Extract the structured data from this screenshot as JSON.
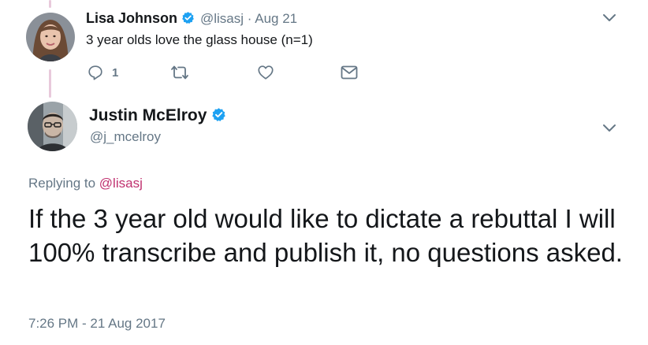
{
  "reply_tweet": {
    "author_name": "Lisa Johnson",
    "author_handle": "@lisasj",
    "separator": "·",
    "date": "Aug 21",
    "text": "3 year olds love the glass house (n=1)",
    "reply_count": "1"
  },
  "main_tweet": {
    "author_name": "Justin McElroy",
    "author_handle": "@j_mcelroy",
    "replying_prefix": "Replying to",
    "replying_to": "@lisasj",
    "text": "If the 3 year old would like to dictate a rebuttal I will 100% transcribe and publish it, no questions asked.",
    "timestamp": "7:26 PM - 21 Aug 2017"
  },
  "icons": {
    "verified": "verified-badge-icon",
    "reply": "reply-icon",
    "retweet": "retweet-icon",
    "like": "heart-icon",
    "dm": "envelope-icon",
    "menu": "chevron-down-icon"
  },
  "colors": {
    "verified_blue": "#1da1f2",
    "thread_line": "#e8c9db",
    "mention": "#c0316f",
    "muted": "#657786"
  }
}
